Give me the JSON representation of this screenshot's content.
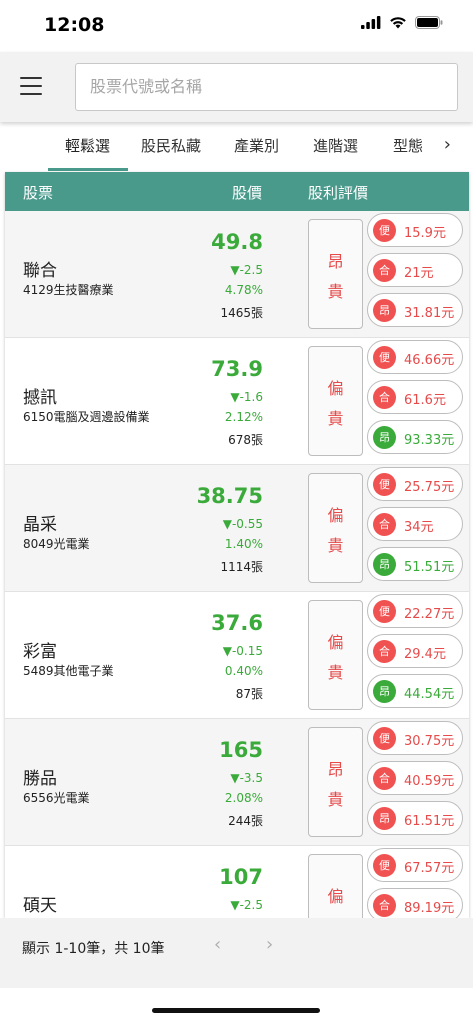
{
  "status_bar": {
    "time": "12:08"
  },
  "header": {
    "search_placeholder": "股票代號或名稱"
  },
  "tabs": [
    {
      "label": "輕鬆選",
      "active": true
    },
    {
      "label": "股民私藏",
      "active": false
    },
    {
      "label": "產業別",
      "active": false
    },
    {
      "label": "進階選",
      "active": false
    },
    {
      "label": "型態",
      "active": false
    }
  ],
  "table_header": {
    "stock": "股票",
    "price": "股價",
    "rating": "股利評價"
  },
  "colors": {
    "accent": "#4a9a8c",
    "up_red": "#e64a4a",
    "down_green": "#3aaa3a"
  },
  "stocks": [
    {
      "name": "聯合",
      "sub": "4129生技醫療業",
      "price": "49.8",
      "change": "▼-2.5",
      "pct": "4.78%",
      "volume": "1465張",
      "rating": [
        "昂",
        "貴"
      ],
      "levels": [
        {
          "tag": "便",
          "value": "15.9元",
          "green": false
        },
        {
          "tag": "合",
          "value": "21元",
          "green": false
        },
        {
          "tag": "昂",
          "value": "31.81元",
          "green": false
        }
      ]
    },
    {
      "name": "撼訊",
      "sub": "6150電腦及週邊設備業",
      "price": "73.9",
      "change": "▼-1.6",
      "pct": "2.12%",
      "volume": "678張",
      "rating": [
        "偏",
        "貴"
      ],
      "levels": [
        {
          "tag": "便",
          "value": "46.66元",
          "green": false
        },
        {
          "tag": "合",
          "value": "61.6元",
          "green": false
        },
        {
          "tag": "昂",
          "value": "93.33元",
          "green": true
        }
      ]
    },
    {
      "name": "晶采",
      "sub": "8049光電業",
      "price": "38.75",
      "change": "▼-0.55",
      "pct": "1.40%",
      "volume": "1114張",
      "rating": [
        "偏",
        "貴"
      ],
      "levels": [
        {
          "tag": "便",
          "value": "25.75元",
          "green": false
        },
        {
          "tag": "合",
          "value": "34元",
          "green": false
        },
        {
          "tag": "昂",
          "value": "51.51元",
          "green": true
        }
      ]
    },
    {
      "name": "彩富",
      "sub": "5489其他電子業",
      "price": "37.6",
      "change": "▼-0.15",
      "pct": "0.40%",
      "volume": "87張",
      "rating": [
        "偏",
        "貴"
      ],
      "levels": [
        {
          "tag": "便",
          "value": "22.27元",
          "green": false
        },
        {
          "tag": "合",
          "value": "29.4元",
          "green": false
        },
        {
          "tag": "昂",
          "value": "44.54元",
          "green": true
        }
      ]
    },
    {
      "name": "勝品",
      "sub": "6556光電業",
      "price": "165",
      "change": "▼-3.5",
      "pct": "2.08%",
      "volume": "244張",
      "rating": [
        "昂",
        "貴"
      ],
      "levels": [
        {
          "tag": "便",
          "value": "30.75元",
          "green": false
        },
        {
          "tag": "合",
          "value": "40.59元",
          "green": false
        },
        {
          "tag": "昂",
          "value": "61.51元",
          "green": false
        }
      ]
    },
    {
      "name": "碩天",
      "sub": "",
      "price": "107",
      "change": "▼-2.5",
      "pct": "",
      "volume": "",
      "rating": [
        "偏",
        ""
      ],
      "levels": [
        {
          "tag": "便",
          "value": "67.57元",
          "green": false
        },
        {
          "tag": "合",
          "value": "89.19元",
          "green": false
        }
      ]
    }
  ],
  "footer": {
    "page_info": "顯示 1-10筆，共 10筆",
    "prev": "‹",
    "next": "›"
  }
}
